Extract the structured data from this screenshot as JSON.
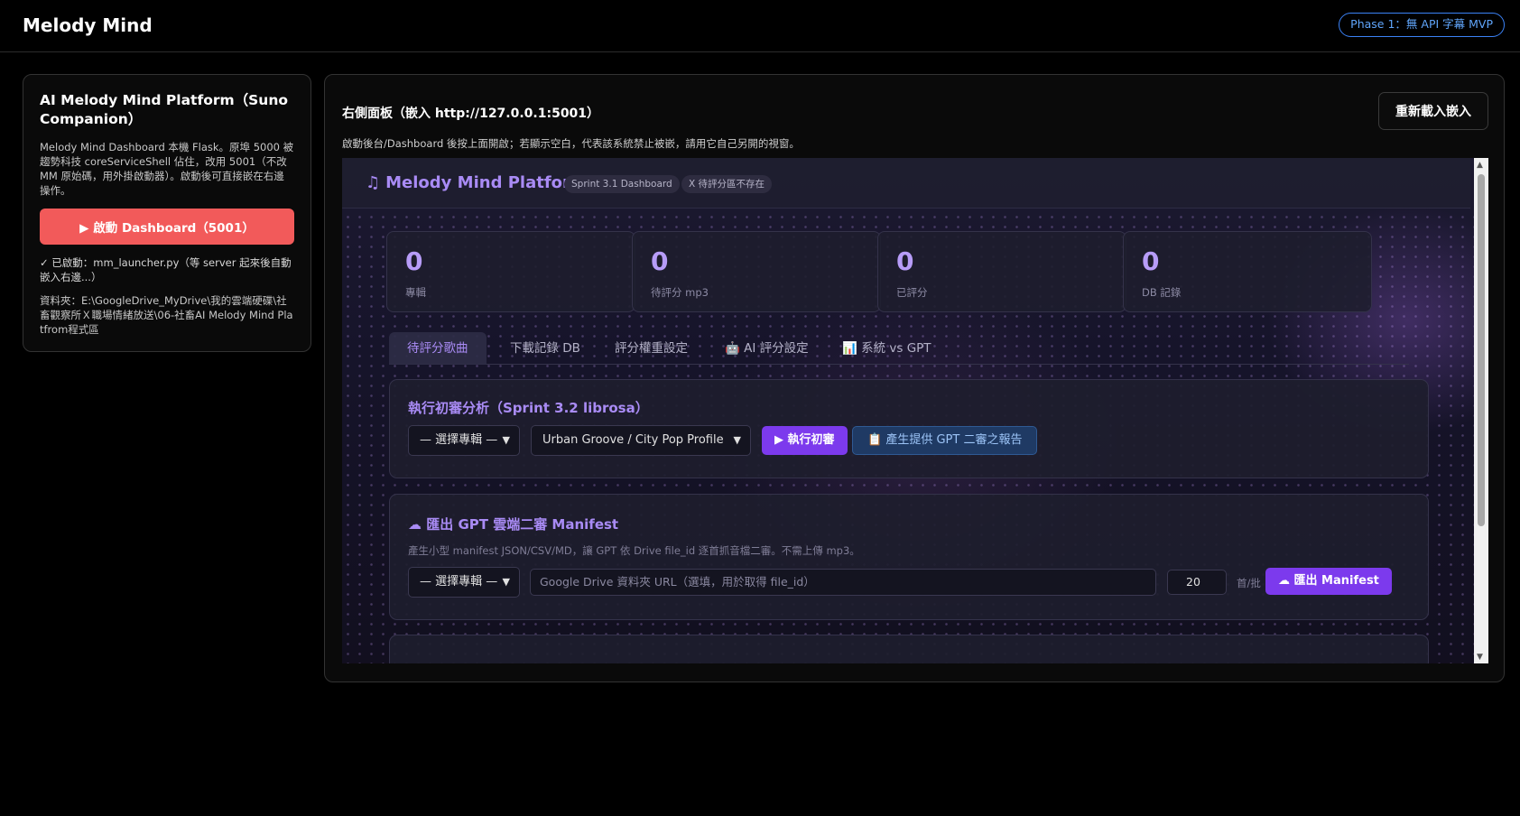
{
  "app": {
    "title": "Melody Mind",
    "phase": "Phase 1：無 API 字幕 MVP"
  },
  "left": {
    "title": "AI Melody Mind Platform（Suno Companion）",
    "desc": "Melody Mind Dashboard 本機 Flask。原埠 5000 被趨勢科技 coreServiceShell 佔住，改用 5001（不改 MM 原始碼，用外掛啟動器）。啟動後可直接嵌在右邊操作。",
    "start_label": "▶ 啟動 Dashboard（5001）",
    "launched": "✓ 已啟動：mm_launcher.py（等 server 起來後自動嵌入右邊...）",
    "folder": "資料夾：E:\\GoogleDrive_MyDrive\\我的雲端硬碟\\社畜觀察所Ｘ職場情緒放送\\06-社畜AI Melody Mind Platfrom程式區"
  },
  "right": {
    "title": "右側面板（嵌入 http://127.0.0.1:5001）",
    "reload_label": "重新載入嵌入",
    "hint": "啟動後台/Dashboard 後按上面開啟；若顯示空白，代表該系統禁止被嵌，請用它自己另開的視窗。"
  },
  "embed": {
    "title": "Melody Mind Platform",
    "badge1": "Sprint 3.1 Dashboard",
    "badge2": "X 待評分區不存在",
    "stats": [
      {
        "value": "0",
        "label": "專輯"
      },
      {
        "value": "0",
        "label": "待評分 mp3"
      },
      {
        "value": "0",
        "label": "已評分"
      },
      {
        "value": "0",
        "label": "DB 記錄"
      }
    ],
    "tabs": [
      "待評分歌曲",
      "下載記錄 DB",
      "評分權重設定",
      "🤖 AI 評分設定",
      "📊 系統 vs GPT"
    ],
    "analysis": {
      "title": "執行初審分析（Sprint 3.2 librosa）",
      "album_select": "— 選擇專輯 —",
      "profile_select": "Urban Groove / City Pop Profile",
      "run_label": "▶ 執行初審",
      "report_label": "📋 產生提供 GPT 二審之報告"
    },
    "manifest": {
      "title": "☁ 匯出 GPT 雲端二審 Manifest",
      "desc": "產生小型 manifest JSON/CSV/MD，讓 GPT 依 Drive file_id 逐首抓音檔二審。不需上傳 mp3。",
      "album_select": "— 選擇專輯 —",
      "url_placeholder": "Google Drive 資料夾 URL（選填，用於取得 file_id）",
      "count": "20",
      "unit": "首/批",
      "export_label": "☁ 匯出 Manifest"
    }
  },
  "colors": {
    "accent": "#a98bf5",
    "start": "#f25a5a",
    "phase": "#3b82f6",
    "button": "#7c3aed"
  }
}
